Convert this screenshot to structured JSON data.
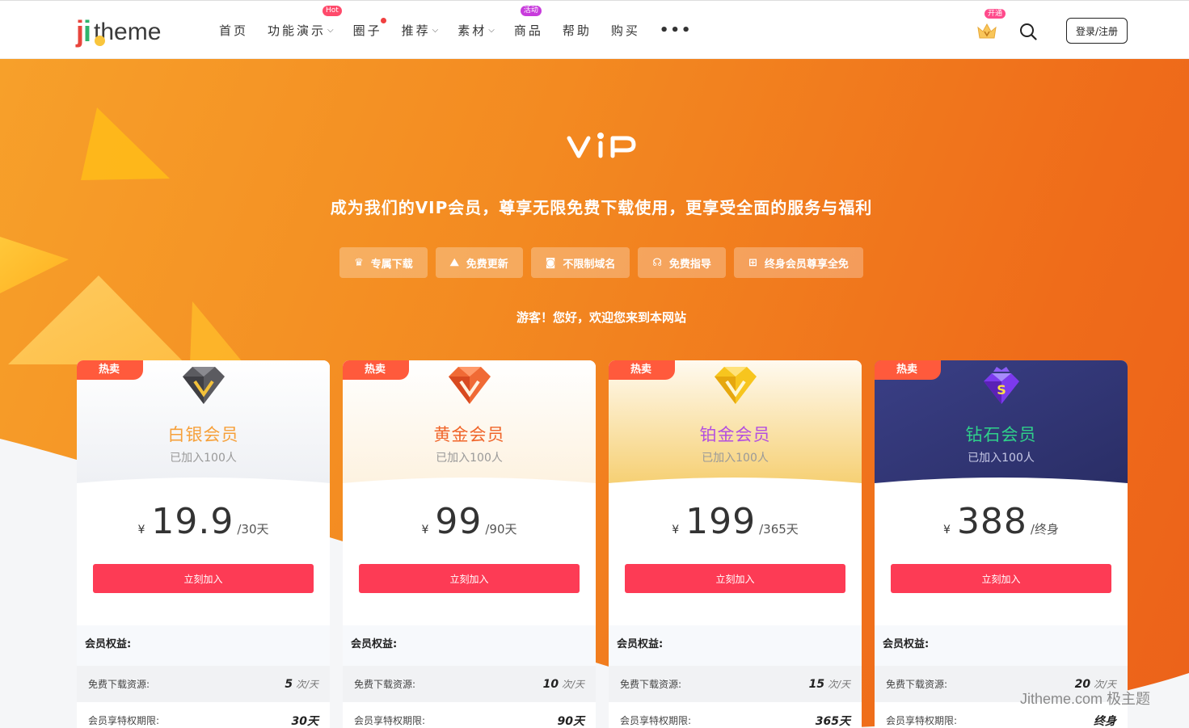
{
  "header": {
    "logo_left": "ji",
    "logo_right": "theme",
    "nav": [
      {
        "label": "首页",
        "dropdown": false
      },
      {
        "label": "功能演示",
        "dropdown": true,
        "badge": "Hot"
      },
      {
        "label": "圈子",
        "dropdown": false,
        "dot": true
      },
      {
        "label": "推荐",
        "dropdown": true
      },
      {
        "label": "素材",
        "dropdown": true
      },
      {
        "label": "商品",
        "dropdown": false,
        "badge": "活动"
      },
      {
        "label": "帮助",
        "dropdown": false
      },
      {
        "label": "购买",
        "dropdown": false
      }
    ],
    "more": "•••",
    "open_badge": "开通",
    "login_label": "登录/注册"
  },
  "hero": {
    "title": "VIP",
    "subtitle": "成为我们的VIP会员，尊享无限免费下载使用，更享受全面的服务与福利",
    "features": [
      {
        "icon": "crown-icon",
        "label": "专属下载"
      },
      {
        "icon": "update-icon",
        "label": "免费更新"
      },
      {
        "icon": "camera-icon",
        "label": "不限制域名"
      },
      {
        "icon": "headset-icon",
        "label": "免费指导"
      },
      {
        "icon": "gift-icon",
        "label": "终身会员尊享全免"
      }
    ],
    "greeting": "游客！您好，欢迎您来到本网站"
  },
  "plans": [
    {
      "tag": "热卖",
      "name": "白银会员",
      "name_color": "#f6a03a",
      "joined": "已加入100人",
      "currency": "¥",
      "price": "19.9",
      "period": "/30天",
      "button": "立刻加入",
      "rights_title": "会员权益:",
      "downloads_label": "免费下载资源:",
      "downloads_num": "5",
      "downloads_unit": "次/天",
      "term_label": "会员享特权期限:",
      "term_value": "30天",
      "gem": "silver"
    },
    {
      "tag": "热卖",
      "name": "黄金会员",
      "name_color": "#f0652a",
      "joined": "已加入100人",
      "currency": "¥",
      "price": "99",
      "period": "/90天",
      "button": "立刻加入",
      "rights_title": "会员权益:",
      "downloads_label": "免费下载资源:",
      "downloads_num": "10",
      "downloads_unit": "次/天",
      "term_label": "会员享特权期限:",
      "term_value": "90天",
      "gem": "gold"
    },
    {
      "tag": "热卖",
      "name": "铂金会员",
      "name_color": "#b34fe0",
      "joined": "已加入100人",
      "currency": "¥",
      "price": "199",
      "period": "/365天",
      "button": "立刻加入",
      "rights_title": "会员权益:",
      "downloads_label": "免费下载资源:",
      "downloads_num": "15",
      "downloads_unit": "次/天",
      "term_label": "会员享特权期限:",
      "term_value": "365天",
      "gem": "platinum"
    },
    {
      "tag": "热卖",
      "name": "钻石会员",
      "name_color": "#2fd18a",
      "joined": "已加入100人",
      "currency": "¥",
      "price": "388",
      "period": "/终身",
      "button": "立刻加入",
      "rights_title": "会员权益:",
      "downloads_label": "免费下载资源:",
      "downloads_num": "20",
      "downloads_unit": "次/天",
      "term_label": "会员享特权期限:",
      "term_value": "终身",
      "gem": "diamond"
    }
  ],
  "watermark": "Jitheme.com 极主题"
}
